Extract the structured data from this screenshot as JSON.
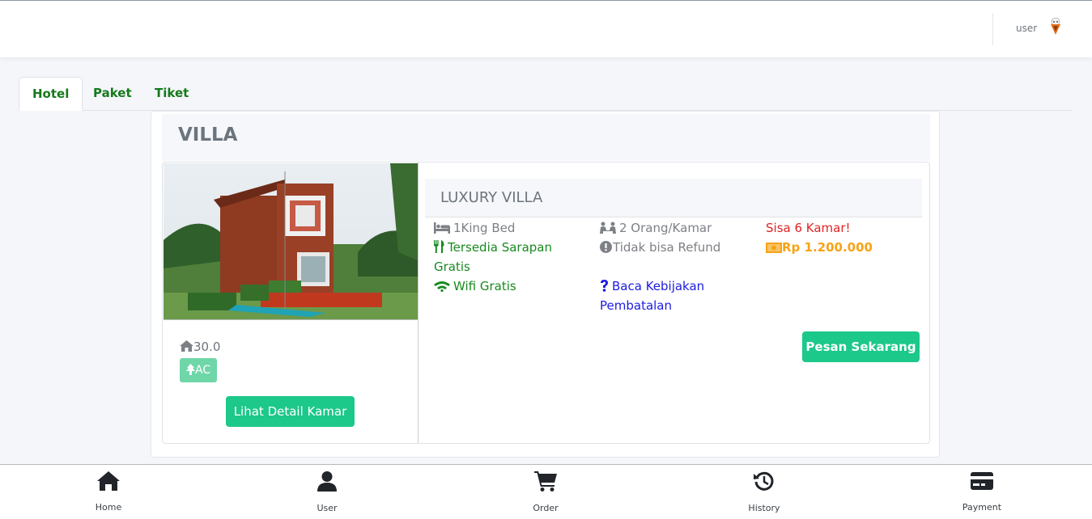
{
  "header": {
    "username": "user"
  },
  "tabs": [
    {
      "label": "Hotel",
      "active": true
    },
    {
      "label": "Paket",
      "active": false
    },
    {
      "label": "Tiket",
      "active": false
    }
  ],
  "category": {
    "title": "VILLA"
  },
  "room": {
    "size": "30.0",
    "facility_badge": "AC",
    "detail_button": "Lihat Detail Kamar",
    "name": "LUXURY VILLA",
    "bed": "1King Bed",
    "breakfast": "Tersedia Sarapan Gratis",
    "wifi": "Wifi Gratis",
    "occupancy": "2 Orang/Kamar",
    "refund": "Tidak bisa Refund",
    "cancel_policy": "Baca Kebijakan Pembatalan",
    "availability": "Sisa 6 Kamar!",
    "price": "Rp 1.200.000",
    "order_button": "Pesan Sekarang"
  },
  "colors": {
    "accent": "#1cc88a",
    "tab_text": "#157a1a",
    "price": "#f6a317",
    "availability": "#e02424",
    "link": "#1c1ce0"
  },
  "bottom_nav": [
    {
      "label": "Home",
      "icon": "home-icon"
    },
    {
      "label": "User",
      "icon": "user-icon"
    },
    {
      "label": "Order",
      "icon": "cart-icon"
    },
    {
      "label": "History",
      "icon": "history-icon"
    },
    {
      "label": "Payment",
      "icon": "credit-card-icon"
    }
  ]
}
